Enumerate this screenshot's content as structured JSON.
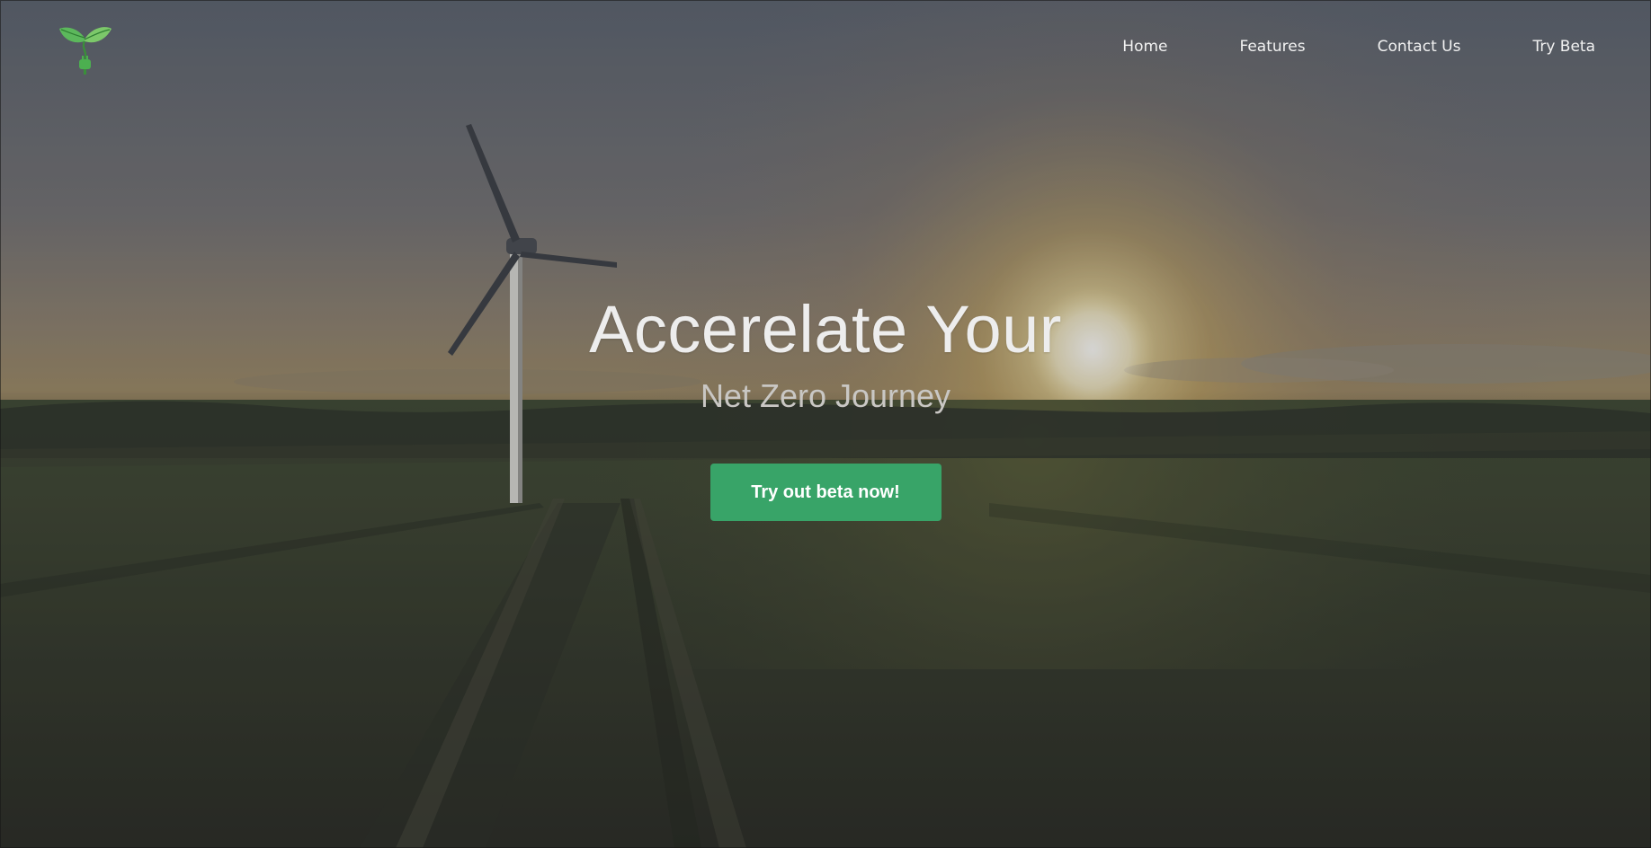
{
  "logo": {
    "icon": "leaf-plug-icon",
    "color": "#4caf50"
  },
  "nav": {
    "items": [
      {
        "label": "Home"
      },
      {
        "label": "Features"
      },
      {
        "label": "Contact Us"
      },
      {
        "label": "Try Beta"
      }
    ]
  },
  "hero": {
    "title": "Accerelate Your",
    "subtitle": "Net Zero Journey",
    "cta_label": "Try out beta now!",
    "cta_color": "#38a468",
    "background": "wind-turbine-sunset-field"
  }
}
